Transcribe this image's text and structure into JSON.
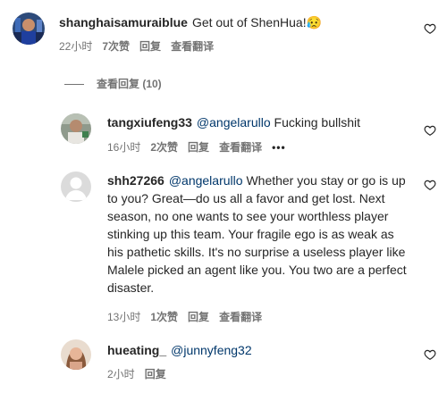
{
  "comments": [
    {
      "username": "shanghaisamuraiblue",
      "mention": "",
      "text": "Get out of ShenHua!😥",
      "time": "22小时",
      "likes": "7次赞",
      "reply": "回复",
      "translate": "查看翻译"
    },
    {
      "username": "tangxiufeng33",
      "mention": "@angelarullo",
      "text": "Fucking bullshit",
      "time": "16小时",
      "likes": "2次赞",
      "reply": "回复",
      "translate": "查看翻译",
      "more": "•••"
    },
    {
      "username": "shh27266",
      "mention": "@angelarullo",
      "text": "Whether you stay or go is up to you? Great—do us all a favor and get lost. Next season, no one wants to see your worthless player stinking up this team. Your fragile ego is as weak as his pathetic skills. It's no surprise a useless player like Malele picked an agent like you. You two are a perfect disaster.",
      "time": "13小时",
      "likes": "1次赞",
      "reply": "回复",
      "translate": "查看翻译"
    },
    {
      "username": "hueating_",
      "mention": "@junnyfeng32",
      "text": "",
      "time": "2小时",
      "reply": "回复"
    }
  ],
  "view_replies": "查看回复 (10)",
  "icons": {
    "heart": "heart-icon",
    "more": "more-options-icon"
  },
  "colors": {
    "mention": "#00376b",
    "meta": "#737373"
  }
}
